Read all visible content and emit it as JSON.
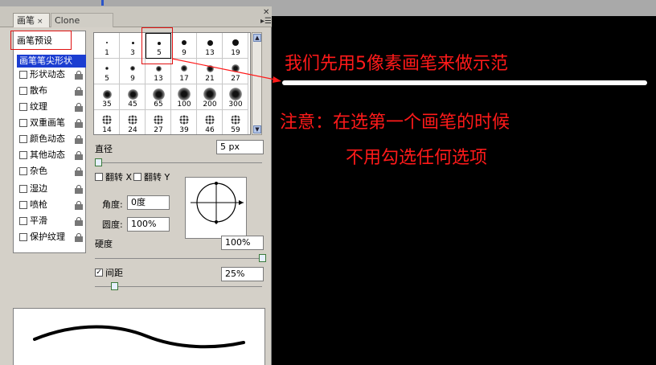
{
  "tabs": {
    "brush": "画笔",
    "clone_source": "Clone Source",
    "close": "×"
  },
  "left_panel": {
    "preset_button": "画笔预设",
    "selected_item": "画笔笔尖形状",
    "options": [
      {
        "label": "形状动态",
        "checked": false,
        "locked": true
      },
      {
        "label": "散布",
        "checked": false,
        "locked": true
      },
      {
        "label": "纹理",
        "checked": false,
        "locked": true
      },
      {
        "label": "双重画笔",
        "checked": false,
        "locked": true
      },
      {
        "label": "颜色动态",
        "checked": false,
        "locked": true
      },
      {
        "label": "其他动态",
        "checked": false,
        "locked": true
      },
      {
        "label": "杂色",
        "checked": false,
        "locked": true
      },
      {
        "label": "湿边",
        "checked": false,
        "locked": true
      },
      {
        "label": "喷枪",
        "checked": false,
        "locked": true
      },
      {
        "label": "平滑",
        "checked": false,
        "locked": true
      },
      {
        "label": "保护纹理",
        "checked": false,
        "locked": true
      }
    ]
  },
  "brush_grid": {
    "rows": [
      [
        "1",
        "3",
        "5",
        "9",
        "13",
        "19"
      ],
      [
        "5",
        "9",
        "13",
        "17",
        "21",
        "27"
      ],
      [
        "35",
        "45",
        "65",
        "100",
        "200",
        "300"
      ],
      [
        "14",
        "24",
        "27",
        "39",
        "46",
        "59"
      ]
    ],
    "selected": "5"
  },
  "controls": {
    "diameter_label": "直径",
    "diameter_value": "5 px",
    "flip_x_label": "翻转 X",
    "flip_y_label": "翻转 Y",
    "angle_label": "角度:",
    "angle_value": "0度",
    "roundness_label": "圆度:",
    "roundness_value": "100%",
    "hardness_label": "硬度",
    "hardness_value": "100%",
    "spacing_label": "间距",
    "spacing_value": "25%",
    "spacing_checked": true
  },
  "annotations": {
    "line1": "我们先用5像素画笔来做示范",
    "line2": "注意：在选第一个画笔的时候",
    "line3": "不用勾选任何选项"
  },
  "colors": {
    "annotation_red": "#ff1a1a",
    "selection_blue": "#1b3dd1",
    "panel_bg": "#d4d0c8"
  }
}
